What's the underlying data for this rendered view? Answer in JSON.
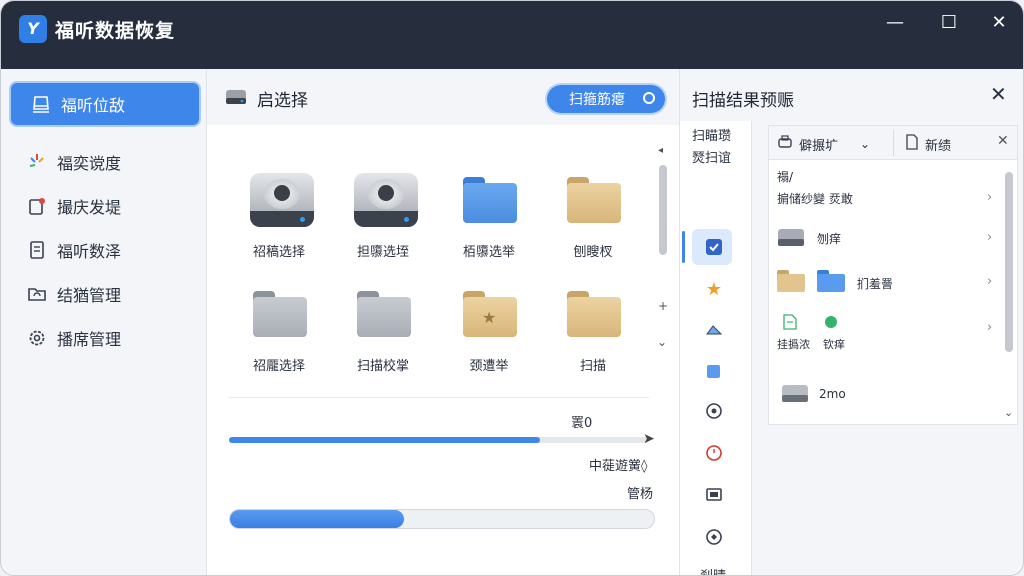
{
  "app": {
    "title": "福听数据恢复",
    "logo": "logo-icon"
  },
  "window_controls": {
    "minimize": "—",
    "maximize": "☐",
    "close": "✕"
  },
  "sidebar": {
    "items": [
      {
        "label": "福听位敌",
        "icon": "drive-icon"
      },
      {
        "label": "福奕谠度",
        "icon": "sparkle-icon"
      },
      {
        "label": "撮庆发堤",
        "icon": "file-alert-icon"
      },
      {
        "label": "福听数泽",
        "icon": "document-icon"
      },
      {
        "label": "结猶管理",
        "icon": "folder-sync-icon"
      },
      {
        "label": "播席管理",
        "icon": "gear-icon"
      }
    ]
  },
  "center": {
    "title": "启选择",
    "scan_button": "扫箍筋瘪",
    "tiles": [
      {
        "label": "祒稿选择",
        "kind": "drive"
      },
      {
        "label": "担隳选垤",
        "kind": "drive"
      },
      {
        "label": "栢隳选举",
        "kind": "folder-blue"
      },
      {
        "label": "刨瞍杈",
        "kind": "folder-tan"
      },
      {
        "label": "祒龎选择",
        "kind": "folder-gray"
      },
      {
        "label": "扫描校掌",
        "kind": "folder-gray"
      },
      {
        "label": "颈遭举",
        "kind": "folder-star"
      },
      {
        "label": "扫描",
        "kind": "folder-tan"
      }
    ],
    "progress_value": "瞏0",
    "progress_fraction": 0.74,
    "status_line1": "中蓰遊黉◊",
    "status_line2": "管杨",
    "progress2_fraction": 0.41
  },
  "right": {
    "title": "扫描结果预赈",
    "close": "✕",
    "vtabs_header": [
      "扫瞄瓒",
      "燹扫谊"
    ],
    "vtabs_icons": [
      "checkbox-icon",
      "star-icon",
      "image-icon",
      "folder-icon",
      "disc-icon",
      "clock-icon",
      "monitor-icon",
      "globe-icon"
    ],
    "vtabs_footer": "刹晴",
    "preview": {
      "tab1": "僻搌圹",
      "tab1_caret": "⌄",
      "tab2": "新绩",
      "close": "✕",
      "path": "禢/",
      "path_line2": "掮储纱變 烎敢",
      "row_drive": "刎痒",
      "row_folders": "扪羞罾",
      "row_files_a": "挂撝浓",
      "row_files_b": "钦痒",
      "row_last": "2mo"
    }
  }
}
